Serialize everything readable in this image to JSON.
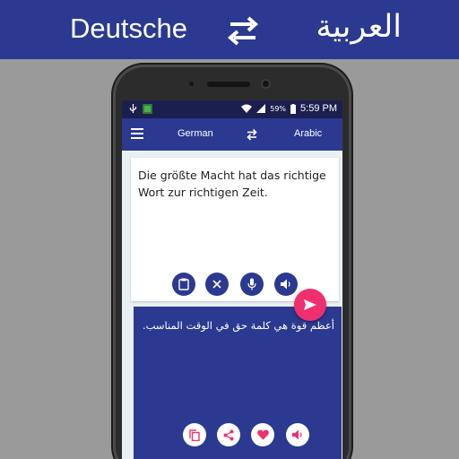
{
  "banner": {
    "left_language": "Deutsche",
    "right_language": "العربية",
    "swap_icon": "swap-arrows-icon"
  },
  "statusbar": {
    "battery": "59%",
    "time": "5:59 PM",
    "icons": [
      "usb-icon",
      "app-notification-icon",
      "wifi-icon",
      "signal-icon",
      "battery-icon"
    ]
  },
  "toolbar": {
    "menu_icon": "hamburger-menu-icon",
    "source_language": "German",
    "target_language": "Arabic",
    "swap_icon": "swap-arrows-icon"
  },
  "input": {
    "text": "Die größte Macht hat das richtige Wort zur richtigen Zeit.",
    "actions": [
      "clipboard-icon",
      "close-icon",
      "microphone-icon",
      "speaker-icon"
    ]
  },
  "send": {
    "icon": "send-icon"
  },
  "output": {
    "text": "أعظم قوة هي كلمة حق في الوقت المناسب.",
    "actions": [
      "copy-icon",
      "share-icon",
      "heart-icon",
      "speaker-icon"
    ]
  },
  "colors": {
    "primary": "#2b3990",
    "accent": "#f0306e",
    "statusbar": "#1b1f4f",
    "background": "#9a9a9a"
  }
}
